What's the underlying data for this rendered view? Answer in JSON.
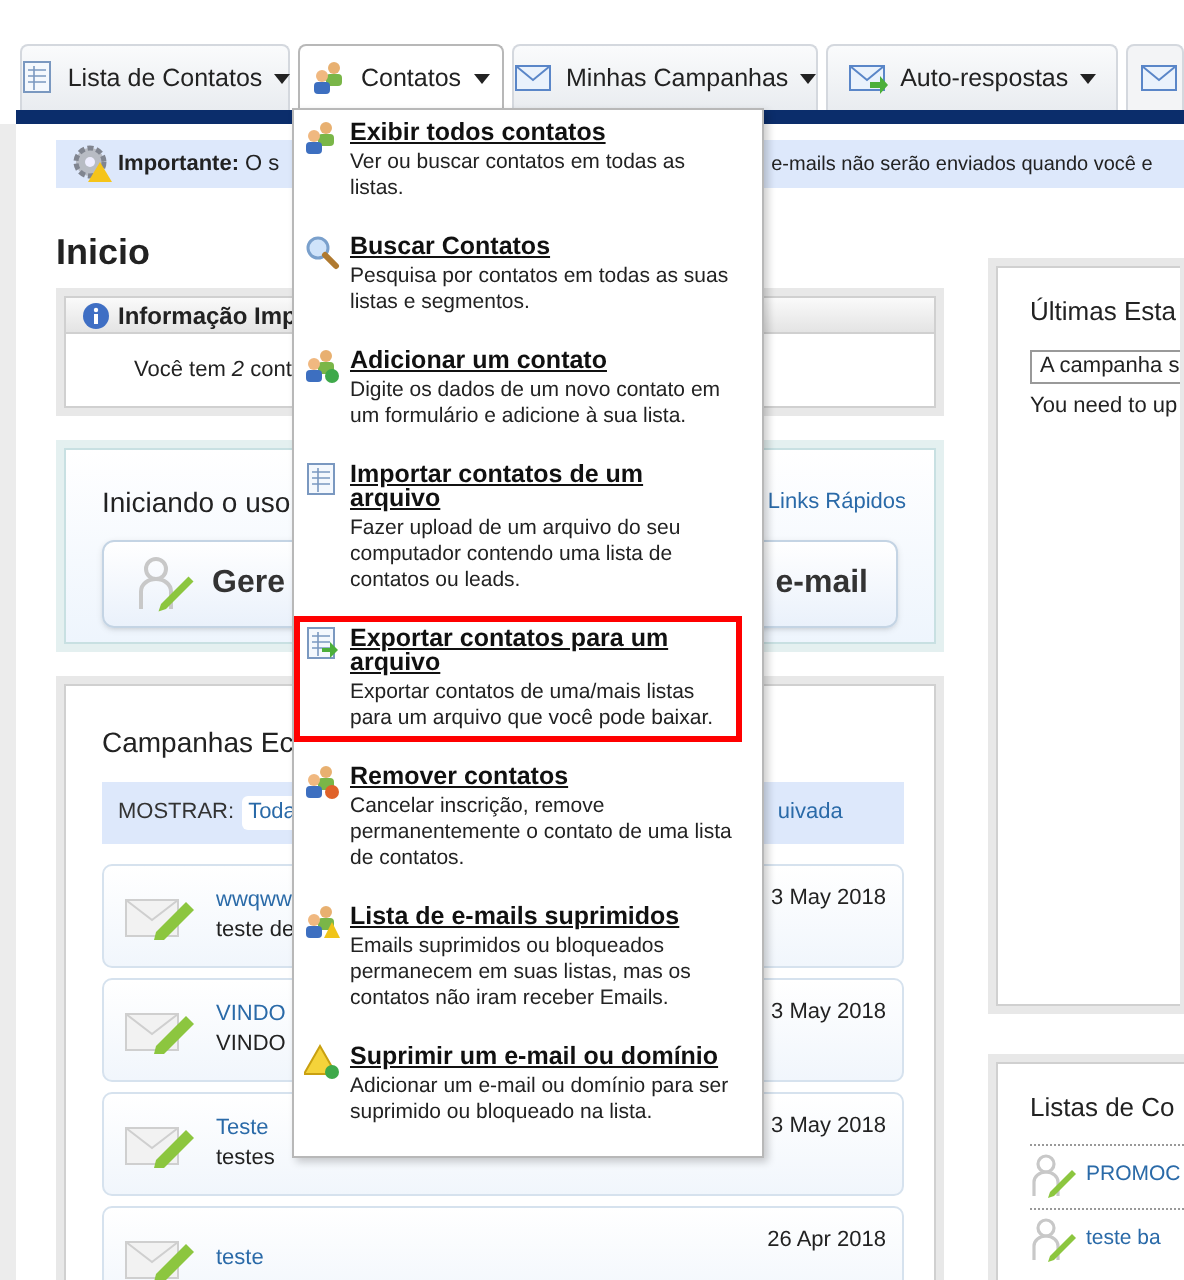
{
  "nav_tabs": [
    {
      "label": "Lista de Contatos",
      "expanded": false
    },
    {
      "label": "Contatos",
      "expanded": true
    },
    {
      "label": "Minhas Campanhas",
      "expanded": false
    },
    {
      "label": "Auto-respostas",
      "expanded": false
    }
  ],
  "notice": {
    "label": "Importante:",
    "text_before": "O s",
    "text_after": "e-mails não serão enviados quando você e"
  },
  "page_title": "Inicio",
  "info_box": {
    "title": "Informação Imp",
    "text": "Você tem *2* cont"
  },
  "getting_started": {
    "title": "Iniciando o uso",
    "quick_links": "Links Rápidos",
    "button_left": "Gere",
    "button_right": "e-mail"
  },
  "campaigns": {
    "title": "Campanhas Ec",
    "filter_label": "MOSTRAR:",
    "filter_first": "Toda",
    "filter_last": "uivada",
    "rows": [
      {
        "title": "wwqww",
        "subtitle": "teste de",
        "date": "3 May 2018"
      },
      {
        "title": "VINDO",
        "subtitle": "VINDO",
        "date": "3 May 2018"
      },
      {
        "title": "Teste",
        "subtitle": "testes",
        "date": "3 May 2018"
      },
      {
        "title": "teste",
        "date": "26 Apr 2018"
      }
    ]
  },
  "stats": {
    "title": "Últimas Esta",
    "select_value": "A campanha s",
    "message": "You need to up"
  },
  "contact_lists": {
    "title": "Listas de Co",
    "rows": [
      {
        "name": "PROMOC"
      },
      {
        "name": "teste ba"
      }
    ]
  },
  "dropdown": {
    "items": [
      {
        "title": "Exibir todos contatos",
        "description": "Ver ou buscar contatos em todas as listas.",
        "highlighted": false
      },
      {
        "title": "Buscar Contatos",
        "description": "Pesquisa por contatos em todas as suas listas e segmentos.",
        "highlighted": false
      },
      {
        "title": "Adicionar um contato",
        "description": "Digite os dados de um novo contato em um formulário e adicione à sua lista.",
        "highlighted": false
      },
      {
        "title": "Importar contatos de um arquivo",
        "description": "Fazer upload de um arquivo do seu computador contendo uma lista de contatos ou leads.",
        "highlighted": false
      },
      {
        "title": "Exportar contatos para um arquivo",
        "description": "Exportar contatos de uma/mais listas para um arquivo que você pode baixar.",
        "highlighted": true
      },
      {
        "title": "Remover contatos",
        "description": "Cancelar inscrição, remove permanentemente o contato de uma lista de contatos.",
        "highlighted": false
      },
      {
        "title": "Lista de e-mails suprimidos",
        "description": "Emails suprimidos ou bloqueados permanecem em suas listas, mas os contatos não iram receber Emails.",
        "highlighted": false
      },
      {
        "title": "Suprimir um e-mail ou domínio",
        "description": "Adicionar um e-mail ou domínio para ser suprimido ou bloqueado na lista.",
        "highlighted": false
      }
    ]
  }
}
